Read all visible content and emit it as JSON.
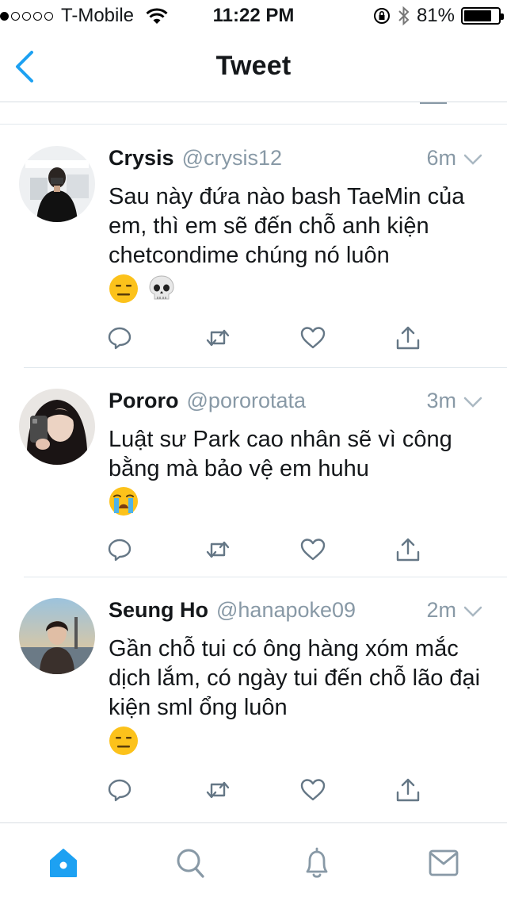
{
  "status_bar": {
    "carrier": "T-Mobile",
    "time": "11:22 PM",
    "battery": "81%",
    "battery_level": 0.81
  },
  "nav": {
    "title": "Tweet",
    "back_icon": "chevron-left-icon"
  },
  "colors": {
    "accent": "#1da1f2",
    "muted": "#8899a6",
    "icon": "#657786",
    "divider": "#e1e8ed"
  },
  "tweets": [
    {
      "author": "Crysis",
      "handle": "@crysis12",
      "time": "6m",
      "text": "Sau này đứa nào bash TaeMin của em, thì em sẽ đến chỗ anh kiện chetcondime chúng nó luôn",
      "emojis": [
        "expressionless-face-emoji",
        "skull-emoji"
      ]
    },
    {
      "author": "Pororo",
      "handle": "@pororotata",
      "time": "3m",
      "text": "Luật sư Park cao nhân sẽ vì công bằng mà bảo vệ em huhu",
      "emojis": [
        "loudly-crying-face-emoji"
      ]
    },
    {
      "author": "Seung Ho",
      "handle": "@hanapoke09",
      "time": "2m",
      "text": "Gần chỗ tui có ông hàng xóm mắc dịch lắm, có ngày tui đến chỗ lão đại kiện sml ổng luôn",
      "emojis": [
        "expressionless-face-emoji"
      ]
    }
  ],
  "tweet_actions": [
    "reply-icon",
    "retweet-icon",
    "like-icon",
    "share-icon"
  ],
  "tab_bar": [
    "home-icon",
    "search-icon",
    "notifications-icon",
    "messages-icon"
  ]
}
